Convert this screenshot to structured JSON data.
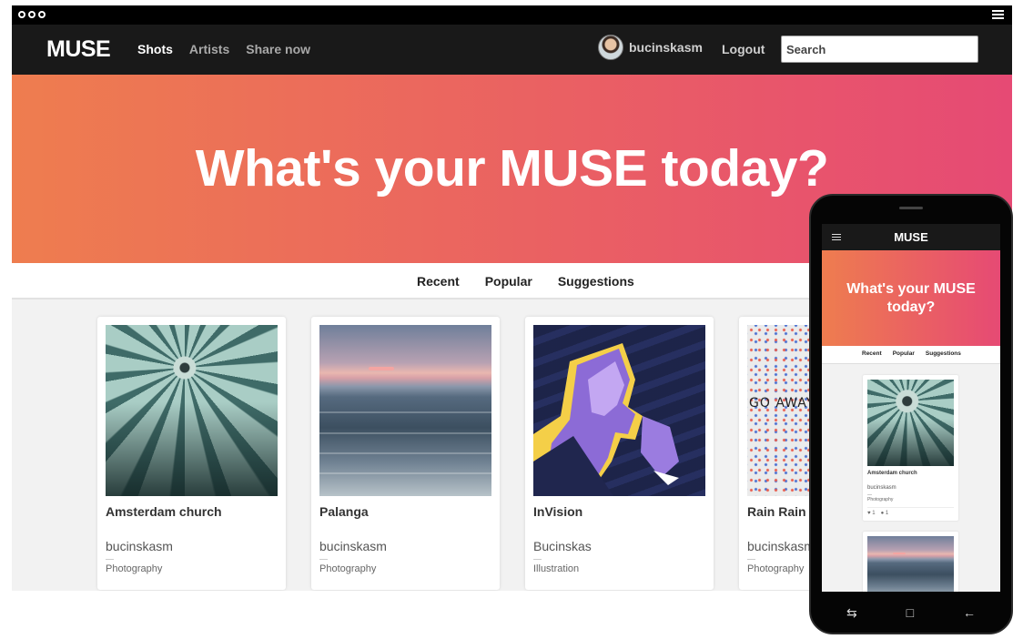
{
  "app": {
    "brand": "MUSE",
    "nav": [
      {
        "label": "Shots",
        "active": true
      },
      {
        "label": "Artists",
        "active": false
      },
      {
        "label": "Share now",
        "active": false
      }
    ],
    "user": {
      "name": "bucinskasm"
    },
    "logout_label": "Logout",
    "search": {
      "value": "",
      "placeholder": "Search"
    }
  },
  "hero": {
    "headline": "What's your MUSE today?"
  },
  "tabs": [
    "Recent",
    "Popular",
    "Suggestions"
  ],
  "cards": [
    {
      "title": "Amsterdam church",
      "author": "bucinskasm",
      "category": "Photography",
      "image": "church-dome-photo"
    },
    {
      "title": "Palanga",
      "author": "bucinskasm",
      "category": "Photography",
      "image": "sea-sunset-photo"
    },
    {
      "title": "InVision",
      "author": "Bucinskas",
      "category": "Illustration",
      "image": "portrait-illustration"
    },
    {
      "title": "Rain Rain Go Away",
      "author": "bucinskasm",
      "category": "Photography",
      "image": "dotted-art-photo"
    }
  ],
  "mobile": {
    "brand": "MUSE",
    "headline": "What's your MUSE today?",
    "tabs": [
      "Recent",
      "Popular",
      "Suggestions"
    ],
    "card": {
      "title": "Amsterdam church",
      "author": "bucinskasm",
      "category": "Photography",
      "likes": "1",
      "comments": "1"
    },
    "icons": [
      "recent-apps-icon",
      "home-icon",
      "back-icon"
    ]
  },
  "colors": {
    "navbar": "#191919",
    "hero_start": "#ee7d4f",
    "hero_end": "#e64a74",
    "background": "#f2f2f2"
  }
}
